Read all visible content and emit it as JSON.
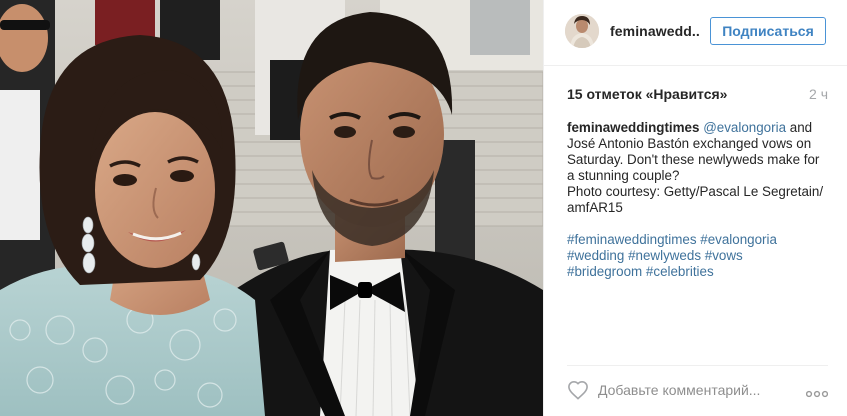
{
  "post": {
    "photo_alt": "Couple at a formal event",
    "author": {
      "username_short": "feminawedd..",
      "username": "feminaweddingtimes"
    },
    "follow_label": "Подписаться",
    "likes_text": "15 отметок «Нравится»",
    "time_text": "2 ч",
    "caption": {
      "mention": "@evalongoria",
      "lines": [
        " and",
        "José Antonio Bastón exchanged vows on",
        "Saturday. Don't these newlyweds make for",
        "a stunning couple?",
        "Photo courtesy: Getty/Pascal Le Segretain/",
        "amfAR15"
      ],
      "hashtags": [
        [
          "#feminaweddingtimes",
          "#evalongoria"
        ],
        [
          "#wedding",
          "#newlyweds",
          "#vows"
        ],
        [
          "#bridegroom",
          "#celebrities"
        ]
      ]
    },
    "comment_placeholder": "Добавьте комментарий...",
    "icons": {
      "like": "heart-outline-icon",
      "more": "ellipsis-icon"
    },
    "colors": {
      "follow": "#3f83c2",
      "link": "#3f729b",
      "border": "#efefef",
      "muted": "#a5a7aa"
    }
  }
}
